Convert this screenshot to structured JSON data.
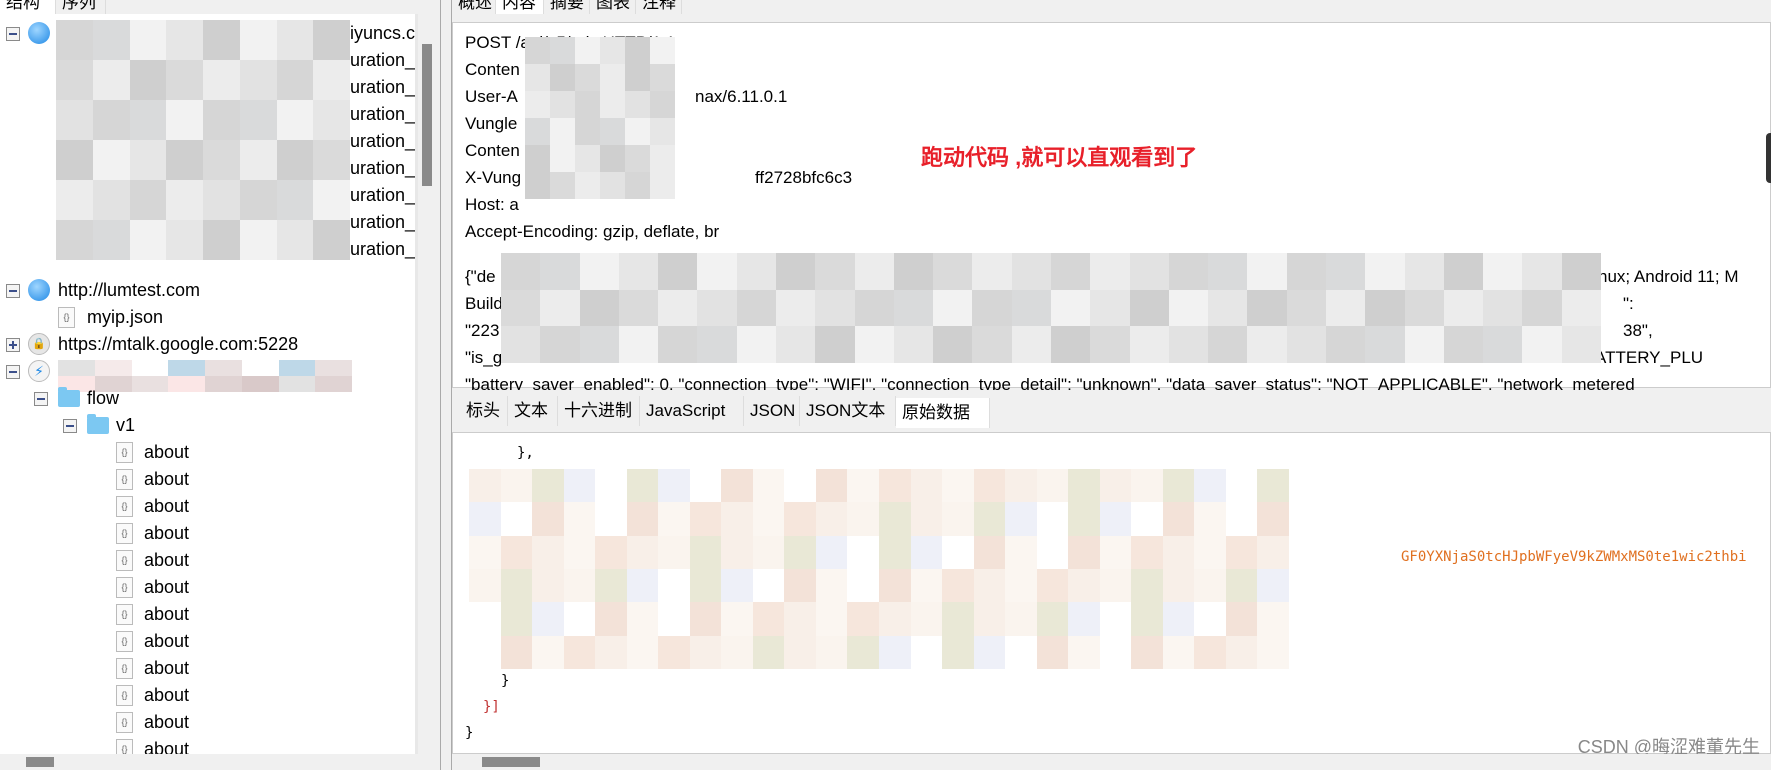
{
  "left_tabs": [
    "结构",
    "序列"
  ],
  "right_tabs": [
    "概述",
    "内容",
    "摘要",
    "图表",
    "注释"
  ],
  "right_tab_selected": "内容",
  "tree": {
    "host1_suffix": "iyuncs.c",
    "host1_children_suffix": "uration_",
    "host2": "http://lumtest.com",
    "host2_child": "myip.json",
    "host3": "https://mtalk.google.com:5228",
    "folder1": "flow",
    "folder2": "v1",
    "item_label": "about"
  },
  "request": {
    "lines": [
      "POST /api/v5/ads HTTP/1.1",
      "Conten",
      "User-A",
      "Vungle",
      "Conten",
      "X-Vung",
      "Host: a",
      "Accept-Encoding: gzip, deflate, br"
    ],
    "line_suffixes": {
      "user_agent": "nax/6.11.0.1",
      "x_vungle": "ff2728bfc6c3"
    },
    "body_prefixes": [
      "{\"de",
      "Build",
      "\"223",
      "\"is_g"
    ],
    "body_suffixes": [
      "nux; Android 11; M",
      "\":",
      "38\",",
      "te\": \"BATTERY_PLU"
    ],
    "body_last_line": "\"battery_saver_enabled\": 0, \"connection_type\": \"WIFI\", \"connection_type_detail\": \"unknown\", \"data_saver_status\": \"NOT_APPLICABLE\", \"network_metered"
  },
  "annotation": "跑动代码 ,就可以直观看到了",
  "sub_tabs": [
    "标头",
    "文本",
    "十六进制",
    "JavaScript",
    "JSON",
    "JSON文本",
    "原始数据"
  ],
  "sub_tab_selected": "原始数据",
  "raw": {
    "l1": "},",
    "encoded": "GF0YXNjaS0tcHJpbWFyeV9kZWMxMS0te1wic2thbi",
    "l3": "}",
    "l4": "}]",
    "l5": "}"
  },
  "watermark": "CSDN @晦涩难董先生",
  "colors": {
    "annotation": "#e8202a",
    "encoded": "#e07020",
    "bracket": "#c03030"
  }
}
